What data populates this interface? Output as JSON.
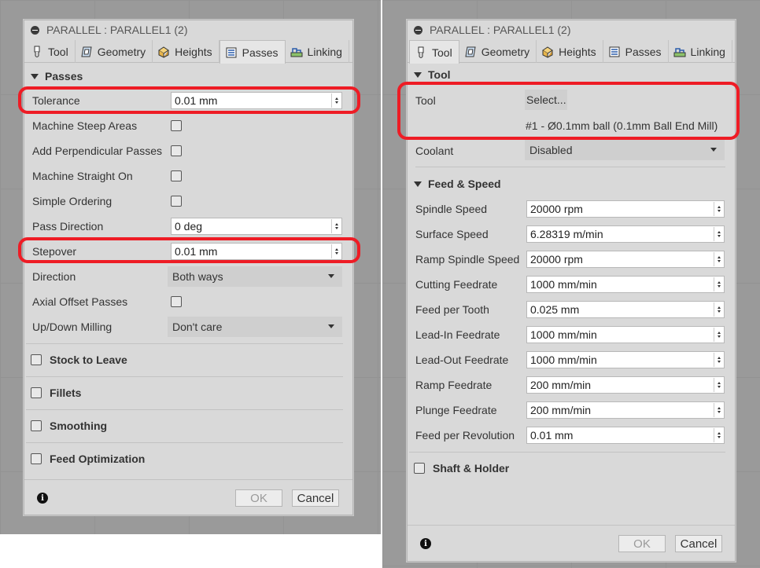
{
  "left": {
    "title": "PARALLEL : PARALLEL1 (2)",
    "tabs": [
      {
        "label": "Tool",
        "icon": "tool-icon",
        "active": false
      },
      {
        "label": "Geometry",
        "icon": "geometry-icon",
        "active": false
      },
      {
        "label": "Heights",
        "icon": "heights-icon",
        "active": false
      },
      {
        "label": "Passes",
        "icon": "passes-icon",
        "active": true
      },
      {
        "label": "Linking",
        "icon": "linking-icon",
        "active": false
      }
    ],
    "section": "Passes",
    "tolerance": {
      "label": "Tolerance",
      "value": "0.01 mm"
    },
    "machine_steep": {
      "label": "Machine Steep Areas"
    },
    "add_perp": {
      "label": "Add Perpendicular Passes"
    },
    "machine_straight": {
      "label": "Machine Straight On"
    },
    "simple_ordering": {
      "label": "Simple Ordering"
    },
    "pass_direction": {
      "label": "Pass Direction",
      "value": "0 deg"
    },
    "stepover": {
      "label": "Stepover",
      "value": "0.01 mm"
    },
    "direction": {
      "label": "Direction",
      "value": "Both ways"
    },
    "axial_offset": {
      "label": "Axial Offset Passes"
    },
    "updown": {
      "label": "Up/Down Milling",
      "value": "Don't care"
    },
    "groups": [
      "Stock to Leave",
      "Fillets",
      "Smoothing",
      "Feed Optimization"
    ],
    "ok": "OK",
    "cancel": "Cancel"
  },
  "right": {
    "title": "PARALLEL : PARALLEL1 (2)",
    "tabs": [
      {
        "label": "Tool",
        "icon": "tool-icon",
        "active": true
      },
      {
        "label": "Geometry",
        "icon": "geometry-icon",
        "active": false
      },
      {
        "label": "Heights",
        "icon": "heights-icon",
        "active": false
      },
      {
        "label": "Passes",
        "icon": "passes-icon",
        "active": false
      },
      {
        "label": "Linking",
        "icon": "linking-icon",
        "active": false
      }
    ],
    "section_tool": "Tool",
    "tool_label": "Tool",
    "tool_select": "Select...",
    "tool_desc": "#1 - Ø0.1mm ball (0.1mm Ball End Mill)",
    "coolant": {
      "label": "Coolant",
      "value": "Disabled"
    },
    "section_feed": "Feed & Speed",
    "feeds": [
      {
        "label": "Spindle Speed",
        "value": "20000 rpm"
      },
      {
        "label": "Surface Speed",
        "value": "6.28319 m/min"
      },
      {
        "label": "Ramp Spindle Speed",
        "value": "20000 rpm"
      },
      {
        "label": "Cutting Feedrate",
        "value": "1000 mm/min"
      },
      {
        "label": "Feed per Tooth",
        "value": "0.025 mm"
      },
      {
        "label": "Lead-In Feedrate",
        "value": "1000 mm/min"
      },
      {
        "label": "Lead-Out Feedrate",
        "value": "1000 mm/min"
      },
      {
        "label": "Ramp Feedrate",
        "value": "200 mm/min"
      },
      {
        "label": "Plunge Feedrate",
        "value": "200 mm/min"
      },
      {
        "label": "Feed per Revolution",
        "value": "0.01 mm"
      }
    ],
    "shaft": "Shaft & Holder",
    "ok": "OK",
    "cancel": "Cancel"
  },
  "colors": {
    "highlight": "#ee1c25",
    "panel": "#d9d9d9",
    "canvas": "#9a9a9a"
  }
}
